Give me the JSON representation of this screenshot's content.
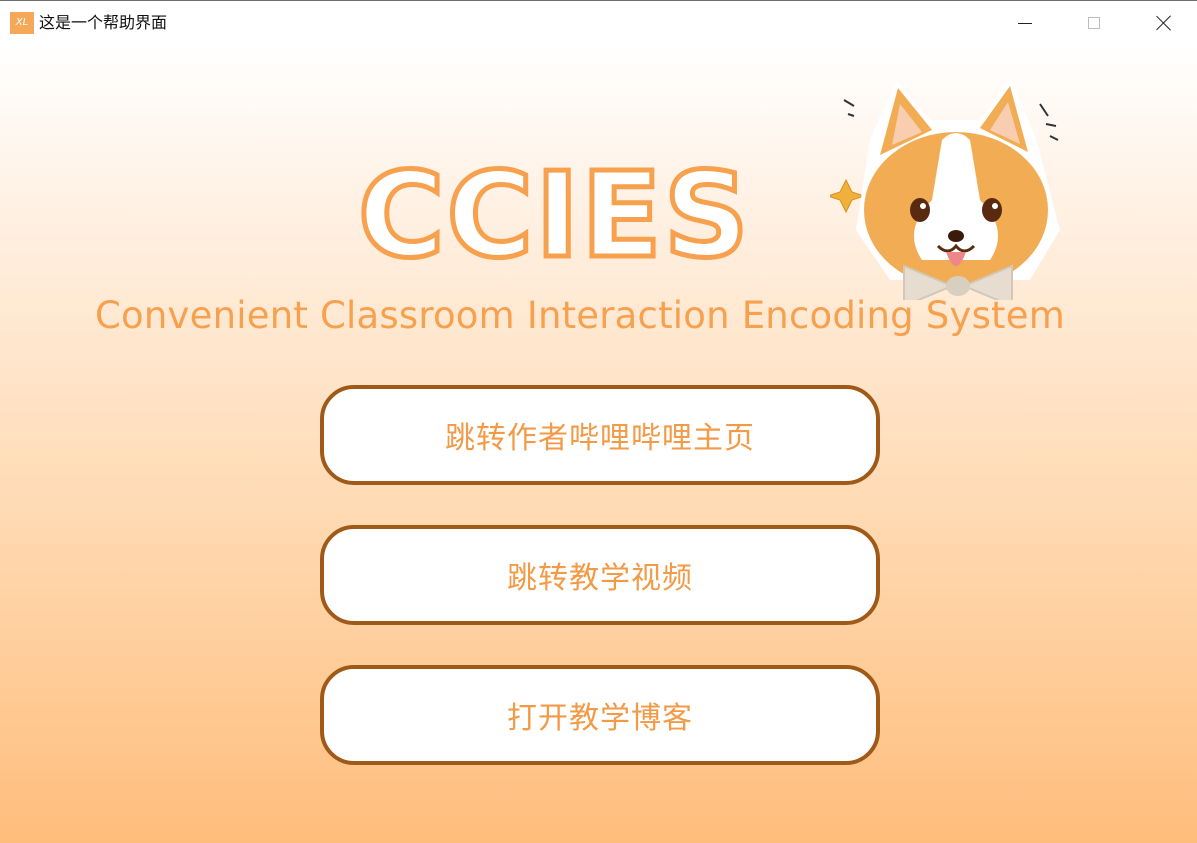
{
  "window": {
    "icon_text": "XL",
    "title": "这是一个帮助界面"
  },
  "logo": {
    "title": "CCIES",
    "subtitle": "Convenient Classroom Interaction Encoding System"
  },
  "buttons": [
    {
      "label": "跳转作者哔哩哔哩主页"
    },
    {
      "label": "跳转教学视频"
    },
    {
      "label": "打开教学博客"
    }
  ],
  "colors": {
    "accent": "#f7a14e",
    "button_border": "#a05a18",
    "background_top": "#ffffff",
    "background_bottom": "#ffbd7c"
  }
}
